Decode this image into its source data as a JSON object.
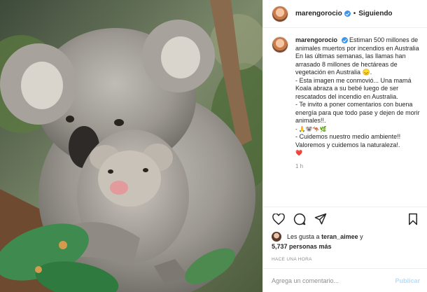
{
  "post": {
    "username": "marengorocio",
    "separator": "•",
    "follow_label": "Siguiendo"
  },
  "caption": {
    "username": "marengorocio",
    "lines": [
      "Estiman 500 millones de animales muertos por incendios en Australia",
      "En las últimas semanas, las llamas han arrasado 8 millones de hectáreas de vegetación en Australia 😞.",
      "- Esta imagen me conmovió... Una mamá Koala abraza a su bebé luego de ser rescatados del incendio en Australia.",
      "- Te invito a poner comentarios con buena energía para que todo pase y dejen de morir animales!!.",
      "- 🙏🐨🦘🌿",
      "- Cuidemos nuestro medio ambiente!! Valoremos y cuidemos la naturaleza!.",
      "❤️"
    ],
    "time": "1 h"
  },
  "likes": {
    "prefix": "Les gusta a",
    "user": "teran_aimee",
    "conj": "y",
    "count_text": "5,737 personas más"
  },
  "posted_ago": "HACE UNA HORA",
  "comment_box": {
    "placeholder": "Agrega un comentario...",
    "publish_label": "Publicar"
  },
  "icons": {
    "like": "heart-icon",
    "comment": "comment-icon",
    "share": "share-icon",
    "save": "bookmark-icon",
    "verified": "verified-badge-icon"
  },
  "colors": {
    "verified": "#3897f0",
    "publish_disabled": "#b2dffc",
    "muted": "#8e8e8e"
  }
}
